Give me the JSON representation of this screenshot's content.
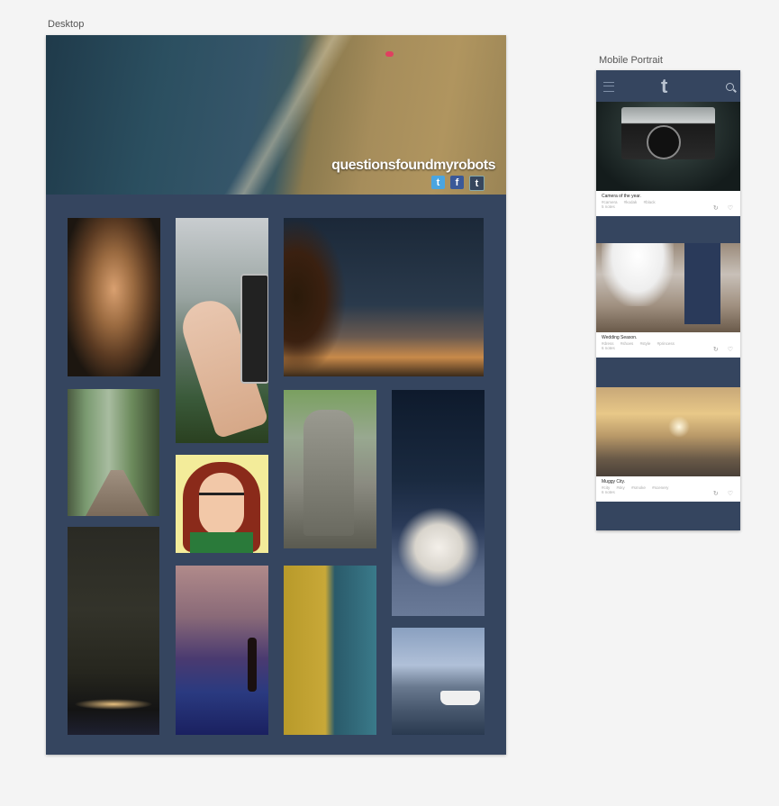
{
  "frames": {
    "desktop_label": "Desktop",
    "mobile_label": "Mobile Portrait"
  },
  "desktop": {
    "blog_title": "questionsfoundmyrobots",
    "social": [
      {
        "icon": "twitter-icon",
        "glyph": "t"
      },
      {
        "icon": "facebook-icon",
        "glyph": "f"
      },
      {
        "icon": "tumblr-icon",
        "glyph": "t"
      }
    ],
    "colors": {
      "background": "#35455f"
    }
  },
  "mobile": {
    "logo_glyph": "t",
    "posts": [
      {
        "caption": "Camera of the year.",
        "tags": [
          "#camera",
          "#kodak",
          "#black"
        ],
        "notes": "5 notes"
      },
      {
        "caption": "Wedding Season.",
        "tags": [
          "#dress",
          "#shoes",
          "#style",
          "#princess"
        ],
        "notes": "6 notes"
      },
      {
        "caption": "Muggy City.",
        "tags": [
          "#city",
          "#sky",
          "#smoke",
          "#scenery"
        ],
        "notes": "6 notes"
      }
    ]
  }
}
